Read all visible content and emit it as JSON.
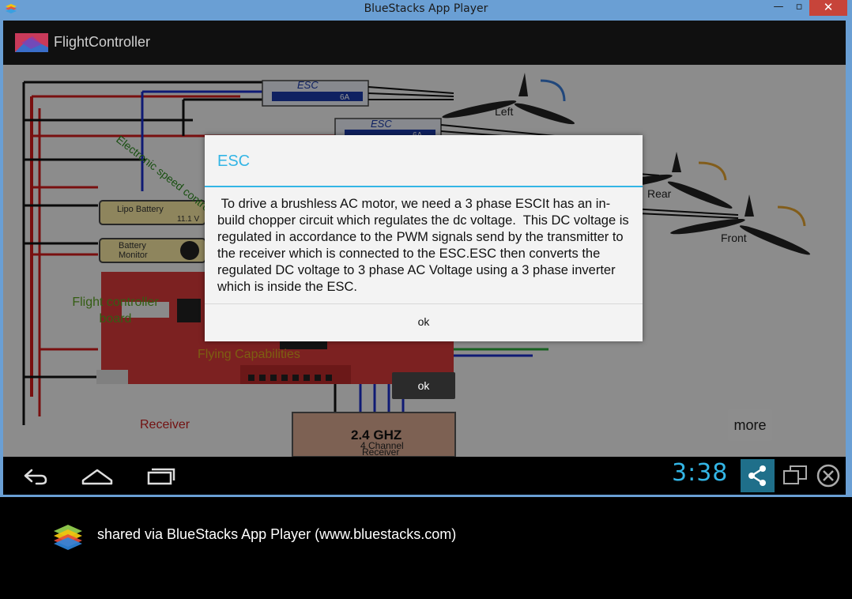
{
  "window": {
    "title": "BlueStacks App Player",
    "minimize_glyph": "—",
    "maximize_glyph": "▫",
    "close_glyph": "✕"
  },
  "app": {
    "title": "FlightController"
  },
  "diagram": {
    "esc_label_1": "ESC",
    "esc_rating_1": "6A",
    "esc_label_2": "ESC",
    "esc_rating_2": "6A",
    "motor_left": "Left",
    "motor_rear": "Rear",
    "motor_front": "Front",
    "esc_text": "Electronic speed controle",
    "lipo_label": "Lipo Battery",
    "lipo_voltage": "11.1 V",
    "battery_monitor_label_1": "Battery",
    "battery_monitor_label_2": "Monitor",
    "fc_board_label": "Flight controller board",
    "flying_caps_label": "Flying Capabilities",
    "receiver_label": "Receiver",
    "receiver_box_line1": "2.4 GHZ",
    "receiver_box_line2": "4 Channel",
    "receiver_box_line3": "Receiver"
  },
  "overlay": {
    "toast_ok": "ok",
    "more_button": "more"
  },
  "dialog": {
    "title": "ESC",
    "message": " To drive a brushless AC motor, we need a 3 phase ESCIt has an in-build chopper circuit which regulates the dc voltage.  This DC voltage is regulated in accordance to the PWM signals send by the transmitter to the receiver which is connected to the ESC.ESC then converts the regulated DC voltage to 3 phase AC Voltage using a 3 phase inverter which is inside the ESC.",
    "ok_button": "ok"
  },
  "navbar": {
    "time": "3:38",
    "icons": [
      "back-icon",
      "home-icon",
      "recent-apps-icon",
      "share-icon",
      "screen-resize-icon",
      "close-app-icon"
    ]
  },
  "footer": {
    "text": "shared via BlueStacks App Player (www.bluestacks.com)"
  },
  "colors": {
    "frame": "#6a9fd4",
    "accent": "#33b5e5",
    "close": "#c7443a",
    "wire_red": "#d11a1a",
    "wire_blue": "#1a2ec8",
    "board_red": "#d63a3a"
  }
}
